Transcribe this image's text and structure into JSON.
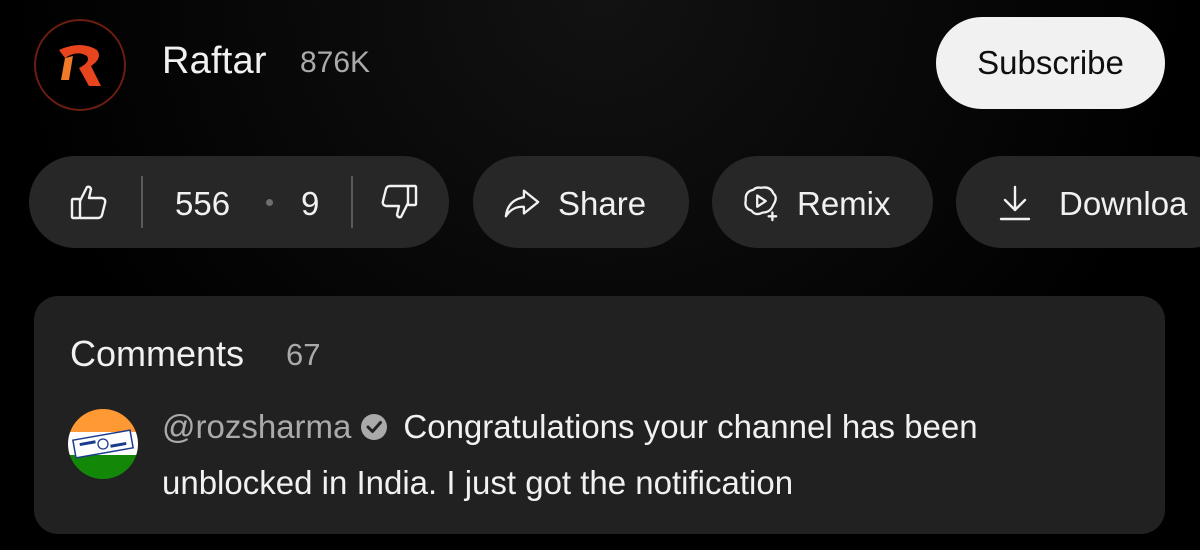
{
  "channel": {
    "name": "Raftar",
    "subscriber_count": "876K",
    "subscribe_label": "Subscribe",
    "logo_icon": "raftar-logo",
    "brand_color": "#e8451f"
  },
  "actions": {
    "like_count": "556",
    "dislike_count": "9",
    "share_label": "Share",
    "remix_label": "Remix",
    "download_label": "Downloa"
  },
  "comments": {
    "title": "Comments",
    "count": "67",
    "top_comment": {
      "author": "@rozsharma",
      "verified": true,
      "text_line1": "Congratulations your channel has been",
      "text_line2": "unblocked in India. I just got the notification"
    }
  },
  "colors": {
    "background": "#000000",
    "pill": "#272727",
    "card": "#212121",
    "subscribe_bg": "#f1f1f1",
    "secondary_text": "#aaaaaa"
  }
}
